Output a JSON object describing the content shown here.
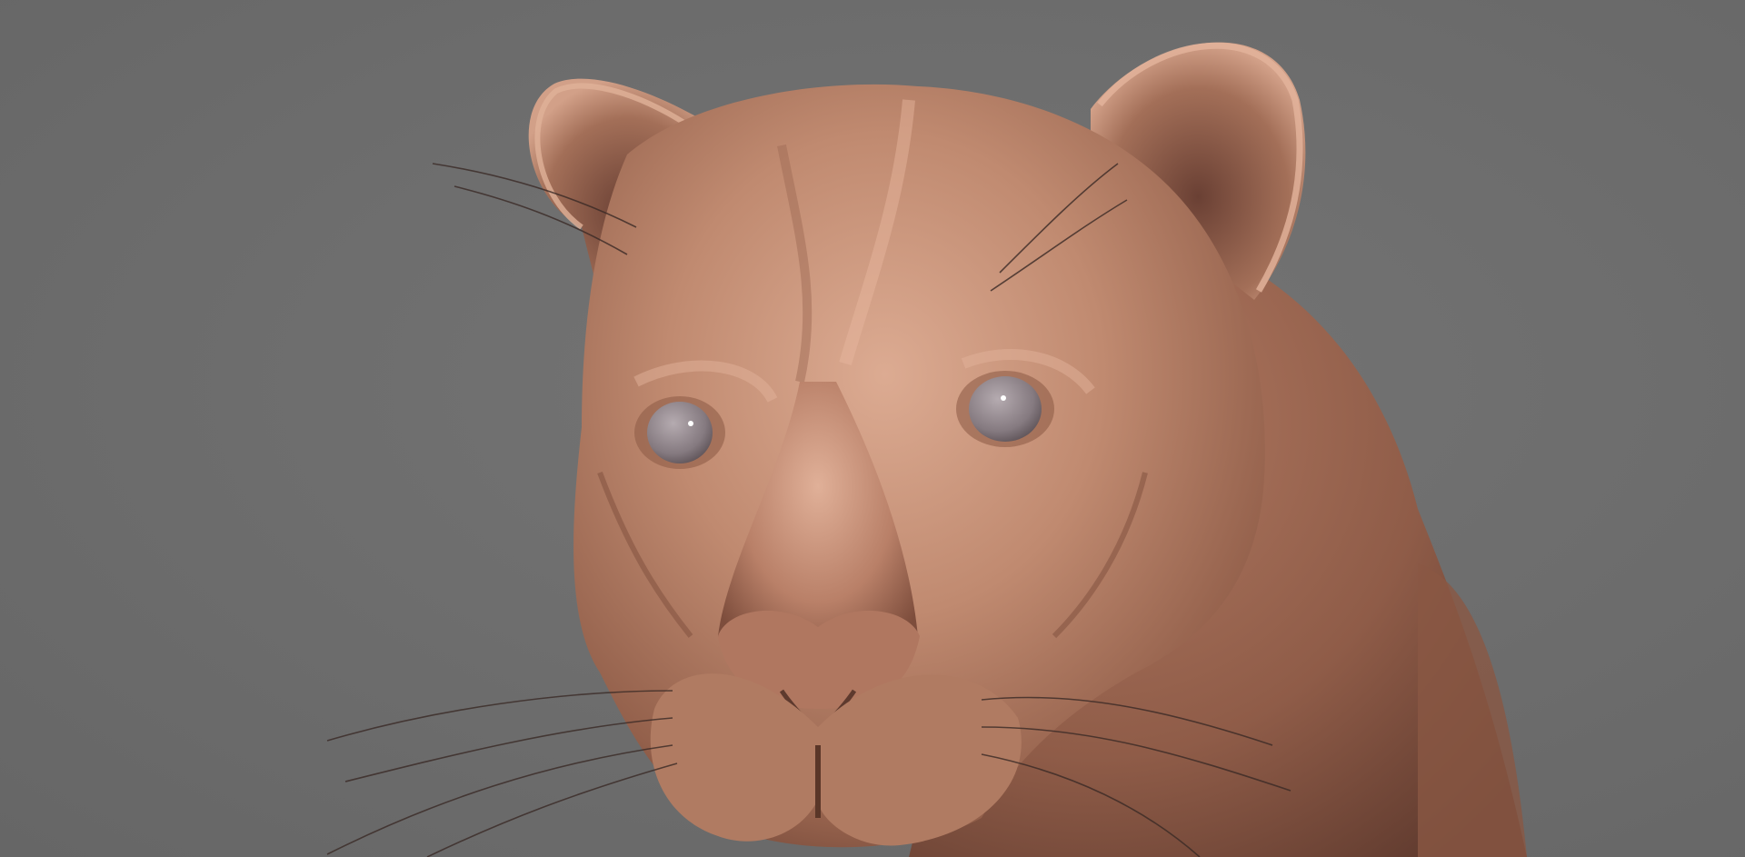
{
  "scene": {
    "subject": "lioness-head-sculpt",
    "colors": {
      "background": "#6e6e6e",
      "clay_light": "#d8a58c",
      "clay_mid": "#b77d64",
      "clay_dark": "#7a4a3a",
      "eye": "#8e8288",
      "whisker": "#3a2a26"
    }
  }
}
